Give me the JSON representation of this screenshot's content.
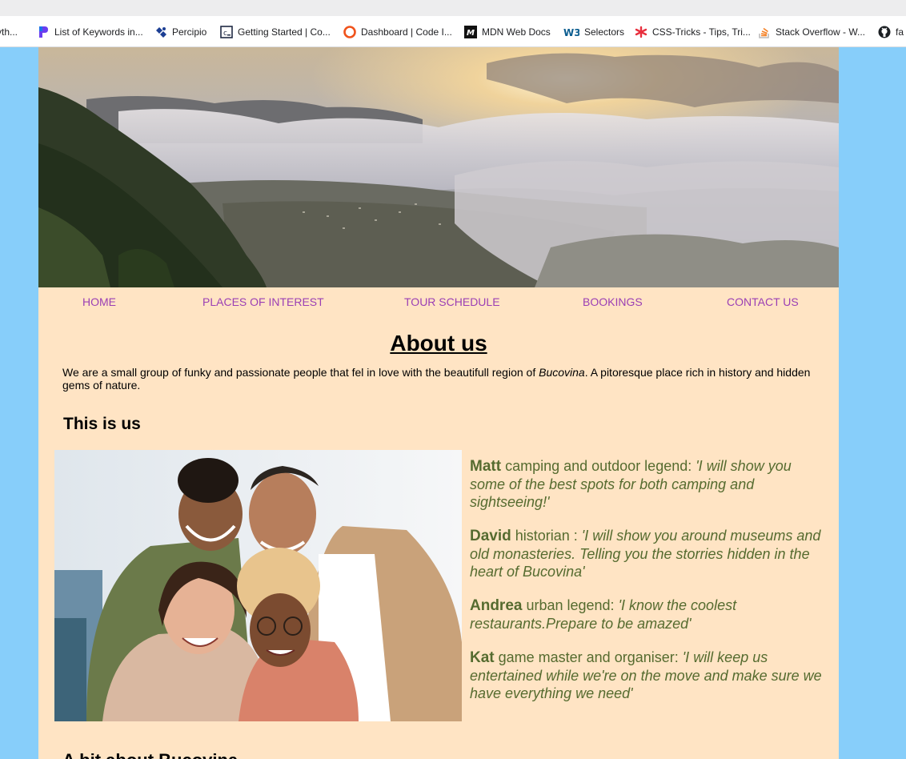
{
  "bookmarks": [
    {
      "label": "yth...",
      "icon": "python-icon"
    },
    {
      "label": "List of Keywords in...",
      "icon": "bookmark-p-icon"
    },
    {
      "label": "Percipio",
      "icon": "percipio-icon"
    },
    {
      "label": "Getting Started | Co...",
      "icon": "codecademy-icon"
    },
    {
      "label": "Dashboard | Code I...",
      "icon": "dashboard-icon"
    },
    {
      "label": "MDN Web Docs",
      "icon": "mdn-icon"
    },
    {
      "label": "Selectors",
      "icon": "w3schools-icon"
    },
    {
      "label": "CSS-Tricks - Tips, Tri...",
      "icon": "css-tricks-icon"
    },
    {
      "label": "Stack Overflow - W...",
      "icon": "stackoverflow-icon"
    },
    {
      "label": "fa",
      "icon": "github-icon"
    }
  ],
  "nav": {
    "home": "HOME",
    "places": "PLACES OF INTEREST",
    "schedule": "TOUR SCHEDULE",
    "bookings": "BOOKINGS",
    "contact": "CONTACT US"
  },
  "about": {
    "title": "About us",
    "text_before": "We are a small group of funky and passionate people that fel in love with the beautifull region of ",
    "text_region": "Bucovina",
    "text_after": ". A pitoresque place rich in history and hidden gems of nature."
  },
  "team": {
    "title": "This is us",
    "members": [
      {
        "name": "Matt",
        "role": " camping and outdoor legend: ",
        "quote": "'I will show you some of the best spots for both camping and sightseeing!'"
      },
      {
        "name": "David",
        "role": " historian : ",
        "quote": "'I will show you around museums and old monasteries. Telling you the storries hidden in the heart of Bucovina'"
      },
      {
        "name": "Andrea",
        "role": " urban legend: ",
        "quote": "'I know the coolest restaurants.Prepare to be amazed'"
      },
      {
        "name": "Kat",
        "role": " game master and organiser: ",
        "quote": "'I will keep us entertained while we're on the move and make sure we have everything we need'"
      }
    ]
  },
  "next_section": {
    "title": "A bit about Bucovina"
  },
  "colors": {
    "page_bg": "#87cefa",
    "content_bg": "#ffe4c4",
    "nav_link": "#9b3fb4",
    "team_text": "#556b2f"
  }
}
